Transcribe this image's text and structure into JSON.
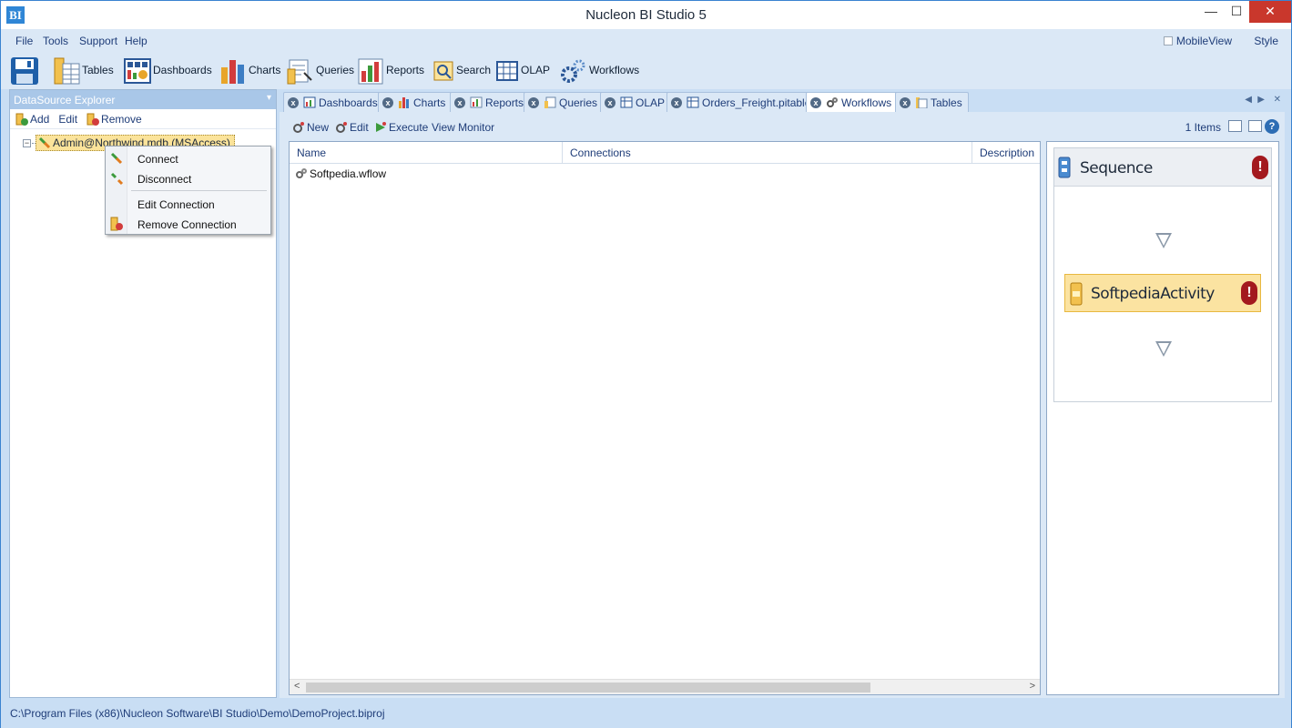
{
  "window": {
    "title": "Nucleon BI Studio 5",
    "app_icon_text": "BI",
    "minimize": "—",
    "maximize": "☐",
    "close": "✕"
  },
  "menu": {
    "items": [
      "File",
      "Tools",
      "Support",
      "Help"
    ],
    "mobileview_label": "MobileView",
    "style_label": "Style"
  },
  "toolbar": {
    "buttons": [
      "Tables",
      "Dashboards",
      "Charts",
      "Queries",
      "Reports",
      "Search",
      "OLAP",
      "Workflows"
    ]
  },
  "datasource_explorer": {
    "title": "DataSource Explorer",
    "pin": "📌",
    "add_label": "Add",
    "edit_label": "Edit",
    "remove_label": "Remove",
    "node_expander": "−",
    "node_label": "Admin@Northwind.mdb (MSAccess)"
  },
  "context_menu": {
    "items": [
      "Connect",
      "Disconnect",
      "Edit Connection",
      "Remove Connection"
    ]
  },
  "tabs": [
    {
      "label": "Dashboards",
      "active": false
    },
    {
      "label": "Charts",
      "active": false
    },
    {
      "label": "Reports",
      "active": false
    },
    {
      "label": "Queries",
      "active": false
    },
    {
      "label": "OLAP",
      "active": false
    },
    {
      "label": "Orders_Freight.pitable",
      "active": false
    },
    {
      "label": "Workflows",
      "active": true
    },
    {
      "label": "Tables",
      "active": false
    }
  ],
  "tab_nav": {
    "prev": "◀",
    "next": "▶",
    "close": "✕"
  },
  "content_toolbar": {
    "new_label": "New",
    "edit_label": "Edit",
    "execute_label": "Execute",
    "monitor_label": "View Monitor",
    "items_count": "1 Items",
    "help": "?"
  },
  "list": {
    "columns": [
      "Name",
      "Connections",
      "Description"
    ],
    "rows": [
      {
        "name": "Softpedia.wflow"
      }
    ],
    "scroll_left": "<",
    "scroll_right": ">"
  },
  "designer": {
    "sequence_title": "Sequence",
    "activity_title": "SoftpediaActivity",
    "error_mark": "!"
  },
  "status": {
    "path": "C:\\Program Files (x86)\\Nucleon Software\\BI Studio\\Demo\\DemoProject.biproj"
  },
  "colors": {
    "accent": "#2f86d6",
    "close_button": "#c9372c",
    "error": "#a3191e",
    "activity_fill": "#fbe3a1"
  }
}
